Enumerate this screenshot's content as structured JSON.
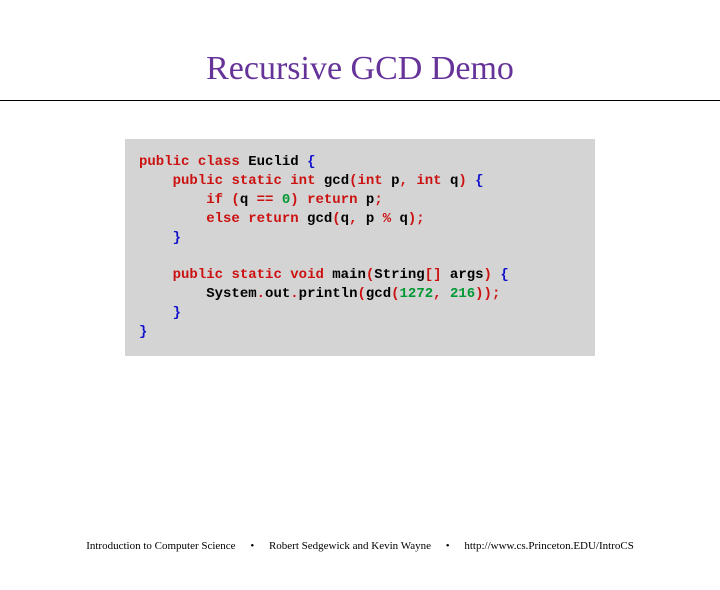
{
  "title": "Recursive GCD Demo",
  "code": {
    "line1_kw1": "public",
    "line1_kw2": "class",
    "line1_name": " Euclid ",
    "line1_brace": "{",
    "line2_indent": "    ",
    "line2_kw1": "public",
    "line2_kw2": "static",
    "line2_kw3": "int",
    "line2_fn": " gcd",
    "line2_p1": "(",
    "line2_kw4": "int",
    "line2_sp1": " p",
    "line2_c1": ",",
    "line2_kw5": " int",
    "line2_sp2": " q",
    "line2_p2": ")",
    "line2_brace": " {",
    "line3_indent": "        ",
    "line3_kw1": "if",
    "line3_p1": " (",
    "line3_var": "q ",
    "line3_eq": "== ",
    "line3_num": "0",
    "line3_p2": ")",
    "line3_kw2": " return",
    "line3_var2": " p",
    "line3_semi": ";",
    "line4_indent": "        ",
    "line4_kw1": "else",
    "line4_kw2": " return",
    "line4_fn": " gcd",
    "line4_p1": "(",
    "line4_v1": "q",
    "line4_c1": ",",
    "line4_v2": " p ",
    "line4_mod": "% ",
    "line4_v3": "q",
    "line4_p2": ");",
    "line5_indent": "    ",
    "line5_brace": "}",
    "line7_indent": "    ",
    "line7_kw1": "public",
    "line7_kw2": "static",
    "line7_kw3": "void",
    "line7_fn": " main",
    "line7_p1": "(",
    "line7_type": "String",
    "line7_br": "[]",
    "line7_arg": " args",
    "line7_p2": ")",
    "line7_brace": " {",
    "line8_indent": "        ",
    "line8_sys": "System",
    "line8_d1": ".",
    "line8_out": "out",
    "line8_d2": ".",
    "line8_pl": "println",
    "line8_p1": "(",
    "line8_gcd": "gcd",
    "line8_p2": "(",
    "line8_n1": "1272",
    "line8_c1": ",",
    "line8_sp": " ",
    "line8_n2": "216",
    "line8_p3": "));",
    "line9_indent": "    ",
    "line9_brace": "}",
    "line10_brace": "}"
  },
  "footer": {
    "left": "Introduction to Computer Science",
    "mid": "Robert Sedgewick and Kevin Wayne",
    "right": "http://www.cs.Princeton.EDU/IntroCS",
    "dot": "•"
  }
}
